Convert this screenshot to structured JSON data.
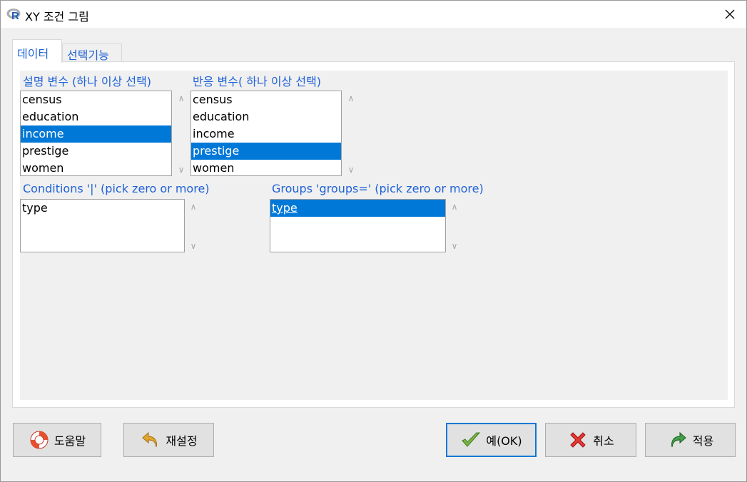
{
  "window": {
    "title": "XY 조건 그림"
  },
  "tabs": [
    {
      "label": "데이터",
      "active": true
    },
    {
      "label": "선택기능",
      "active": false
    }
  ],
  "explanatory": {
    "label": "설명 변수 (하나 이상 선택)",
    "items": [
      "census",
      "education",
      "income",
      "prestige",
      "women"
    ],
    "selected": "income"
  },
  "response": {
    "label": "반응 변수( 하나 이상 선택)",
    "items": [
      "census",
      "education",
      "income",
      "prestige",
      "women"
    ],
    "selected": "prestige"
  },
  "conditions": {
    "label": "Conditions '|' (pick zero or more)",
    "items": [
      "type"
    ]
  },
  "groups": {
    "label": "Groups 'groups=' (pick zero or more)",
    "items": [
      "type"
    ],
    "selected": "type"
  },
  "buttons": {
    "help": "도움말",
    "reset": "재설정",
    "ok": "예(OK)",
    "cancel": "취소",
    "apply": "적용"
  },
  "colors": {
    "accent": "#1f62d6",
    "selection": "#0078d7"
  }
}
